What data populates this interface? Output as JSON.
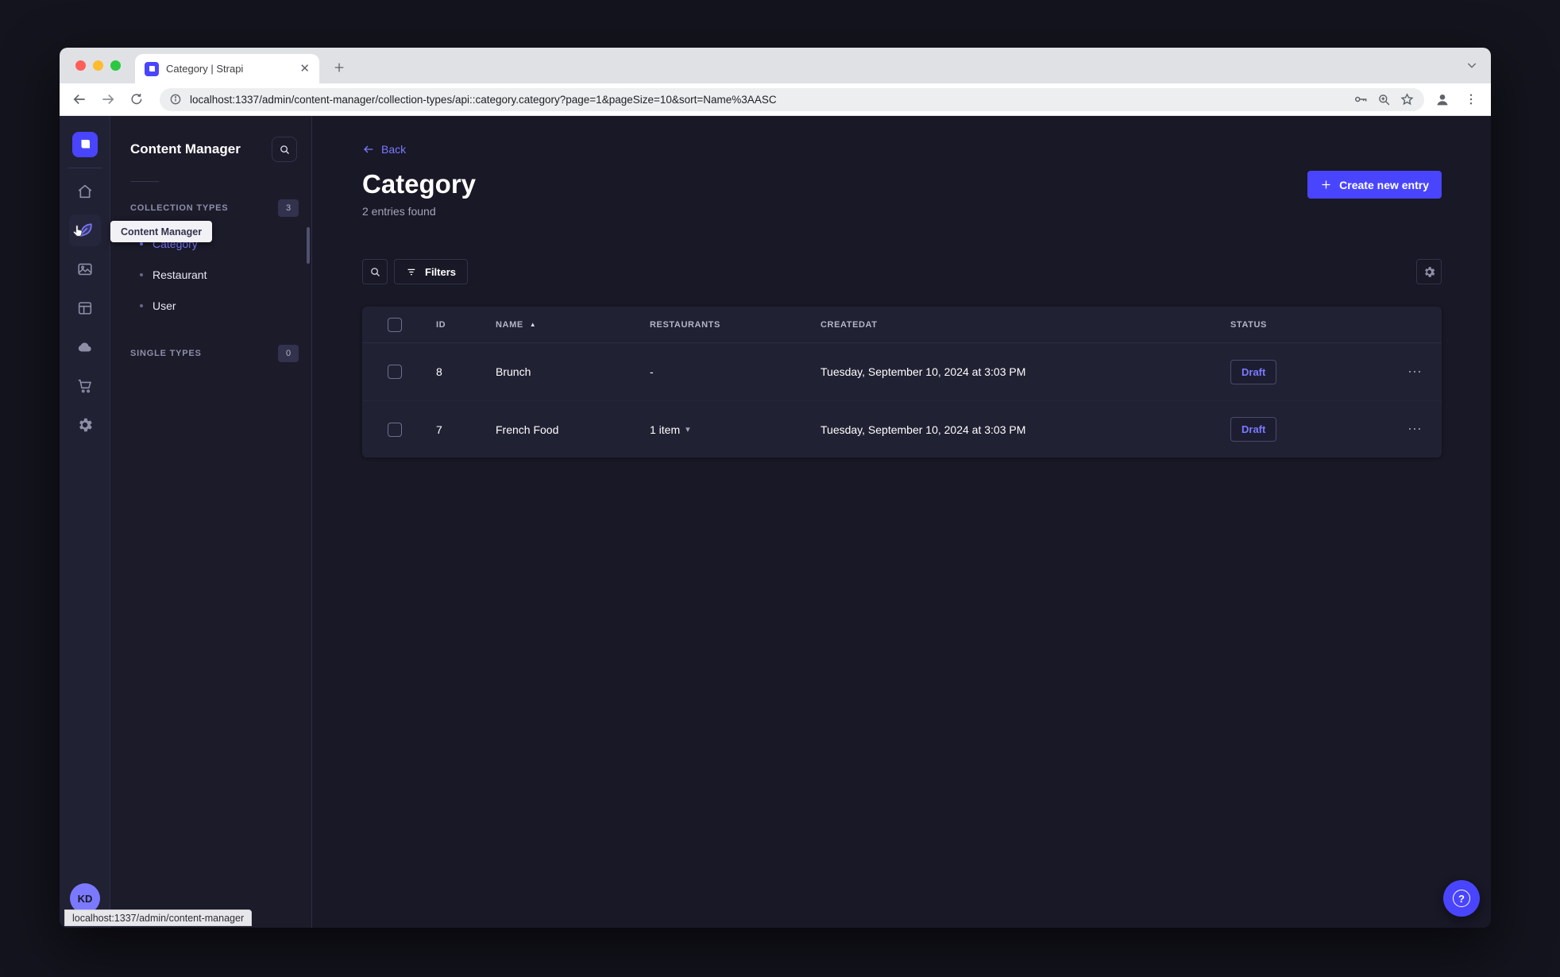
{
  "browser": {
    "tab": {
      "title": "Category | Strapi"
    },
    "url": "localhost:1337/admin/content-manager/collection-types/api::category.category?page=1&pageSize=10&sort=Name%3AASC",
    "status_tooltip": "localhost:1337/admin/content-manager"
  },
  "sidebar": {
    "tooltip": "Content Manager",
    "avatar_initials": "KD",
    "icons": [
      "home",
      "content-manager",
      "media-library",
      "content-type-builder",
      "cloud",
      "marketplace",
      "settings"
    ]
  },
  "subnav": {
    "title": "Content Manager",
    "collection_types": {
      "label": "COLLECTION TYPES",
      "count": "3",
      "items": [
        {
          "label": "Category",
          "active": true
        },
        {
          "label": "Restaurant",
          "active": false
        },
        {
          "label": "User",
          "active": false
        }
      ]
    },
    "single_types": {
      "label": "SINGLE TYPES",
      "count": "0"
    }
  },
  "main": {
    "back_label": "Back",
    "title": "Category",
    "subtitle": "2 entries found",
    "create_button_label": "Create new entry",
    "filters_button_label": "Filters",
    "table": {
      "headers": {
        "id": "ID",
        "name": "NAME",
        "restaurants": "RESTAURANTS",
        "createdat": "CREATEDAT",
        "status": "STATUS"
      },
      "rows": [
        {
          "id": "8",
          "name": "Brunch",
          "restaurants": "-",
          "createdat": "Tuesday, September 10, 2024 at 3:03 PM",
          "status": "Draft"
        },
        {
          "id": "7",
          "name": "French Food",
          "restaurants": "1 item",
          "createdat": "Tuesday, September 10, 2024 at 3:03 PM",
          "status": "Draft"
        }
      ]
    }
  },
  "icons": {
    "ellipsis": "⋯",
    "sort_asc": "▲",
    "chevron_down": "▾",
    "question": "?"
  },
  "colors": {
    "primary": "#4945ff",
    "primary_light": "#7b79ff",
    "surface": "#212134",
    "background": "#181826",
    "draft_text": "#7b79ff"
  }
}
